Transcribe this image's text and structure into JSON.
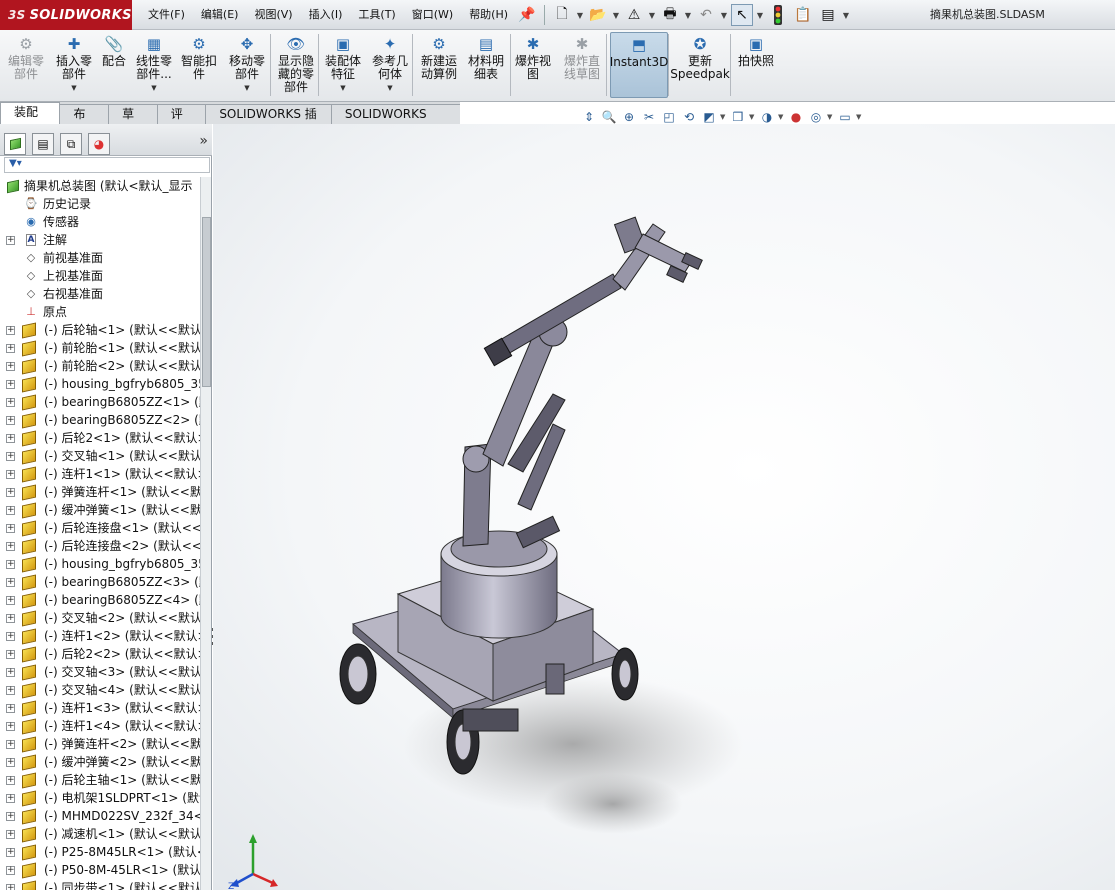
{
  "app": {
    "logo_brand": "SOLIDWORKS",
    "logo_prefix": "3S",
    "document_title": "摘果机总装图.SLDASM"
  },
  "menu": [
    "文件(F)",
    "编辑(E)",
    "视图(V)",
    "插入(I)",
    "工具(T)",
    "窗口(W)",
    "帮助(H)"
  ],
  "ribbon": {
    "buttons": [
      {
        "label": "编辑零\n部件",
        "icon": "edit-component-icon",
        "enabled": false
      },
      {
        "label": "插入零\n部件",
        "icon": "insert-component-icon",
        "enabled": true
      },
      {
        "label": "配合",
        "icon": "mate-icon",
        "enabled": true
      },
      {
        "label": "线性零\n部件...",
        "icon": "linear-pattern-icon",
        "enabled": true
      },
      {
        "label": "智能扣\n件",
        "icon": "smart-fasteners-icon",
        "enabled": true
      },
      {
        "label": "移动零\n部件",
        "icon": "move-component-icon",
        "enabled": true
      },
      {
        "label": "显示隐\n藏的零\n部件",
        "icon": "show-hidden-icon",
        "enabled": true
      },
      {
        "label": "装配体\n特征",
        "icon": "assembly-features-icon",
        "enabled": true
      },
      {
        "label": "参考几\n何体",
        "icon": "reference-geometry-icon",
        "enabled": true
      },
      {
        "label": "新建运\n动算例",
        "icon": "motion-study-icon",
        "enabled": true
      },
      {
        "label": "材料明\n细表",
        "icon": "bom-icon",
        "enabled": true
      },
      {
        "label": "爆炸视\n图",
        "icon": "exploded-view-icon",
        "enabled": true
      },
      {
        "label": "爆炸直\n线草图",
        "icon": "explode-line-sketch-icon",
        "enabled": false
      },
      {
        "label": "Instant3D",
        "icon": "instant3d-icon",
        "enabled": true
      },
      {
        "label": "更新\nSpeedpak",
        "icon": "speedpak-icon",
        "enabled": true
      },
      {
        "label": "拍快照",
        "icon": "snapshot-icon",
        "enabled": true
      }
    ]
  },
  "tabs": [
    "装配体",
    "布局",
    "草图",
    "评估",
    "SOLIDWORKS 插件",
    "SOLIDWORKS MBD"
  ],
  "active_tab": "装配体",
  "feature_tree": {
    "root": "摘果机总装图 (默认<默认_显示",
    "folders": [
      "历史记录",
      "传感器",
      "注解",
      "前视基准面",
      "上视基准面",
      "右视基准面",
      "原点"
    ],
    "components": [
      "(-) 后轮轴<1> (默认<<默认",
      "(-) 前轮胎<1> (默认<<默认",
      "(-) 前轮胎<2> (默认<<默认",
      "(-) housing_bgfryb6805_35",
      "(-) bearingB6805ZZ<1> (默",
      "(-) bearingB6805ZZ<2> (默",
      "(-) 后轮2<1> (默认<<默认>",
      "(-) 交叉轴<1> (默认<<默认",
      "(-) 连杆1<1> (默认<<默认>",
      "(-) 弹簧连杆<1> (默认<<默",
      "(-) 缓冲弹簧<1> (默认<<默",
      "(-) 后轮连接盘<1> (默认<<",
      "(-) 后轮连接盘<2> (默认<<",
      "(-) housing_bgfryb6805_35",
      "(-) bearingB6805ZZ<3> (默",
      "(-) bearingB6805ZZ<4> (默",
      "(-) 交叉轴<2> (默认<<默认",
      "(-) 连杆1<2> (默认<<默认>",
      "(-) 后轮2<2> (默认<<默认>",
      "(-) 交叉轴<3> (默认<<默认",
      "(-) 交叉轴<4> (默认<<默认",
      "(-) 连杆1<3> (默认<<默认>",
      "(-) 连杆1<4> (默认<<默认>",
      "(-) 弹簧连杆<2> (默认<<默",
      "(-) 缓冲弹簧<2> (默认<<默",
      "(-) 后轮主轴<1> (默认<<默",
      "(-) 电机架1SLDPRT<1> (默认",
      "(-) MHMD022SV_232f_34<",
      "(-) 减速机<1> (默认<<默认",
      "(-) P25-8M45LR<1> (默认<",
      "(-) P50-8M-45LR<1> (默认<",
      "(-) 同步带<1> (默认<<默认"
    ]
  },
  "colors": {
    "logo_red": "#b1151f",
    "model_gray": "#a7a5b4",
    "selection_blue": "#7d9ab3"
  }
}
